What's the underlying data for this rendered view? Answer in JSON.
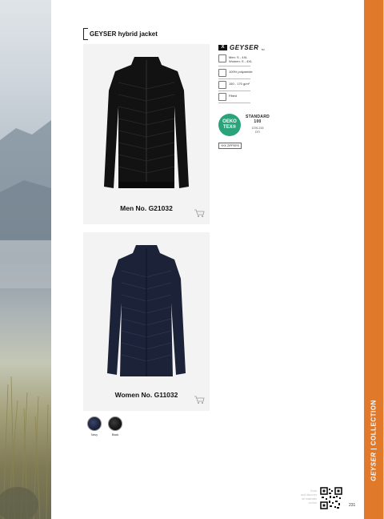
{
  "title": "GEYSER hybrid jacket",
  "brand": {
    "mark": "X",
    "word": "GEYSER",
    "tm": "TM"
  },
  "products": [
    {
      "label": "Men No. G21032",
      "color": "#121212"
    },
    {
      "label": "Women No. G11032",
      "color": "#1c2238"
    }
  ],
  "specs": {
    "sizes": "Men: S - 4XL\nWomen: S - 4XL",
    "material": "100% polyamide",
    "weight": "150 - 170 g/m²",
    "fit": "Fitted"
  },
  "oeko": {
    "badge_line1": "OEKO",
    "badge_line2": "TEX®",
    "standard": "STANDARD\n100",
    "number": "1376-215\nDTI"
  },
  "zipper": "YKK ZIPPERS",
  "swatches": [
    {
      "label": "Navy",
      "color": "#1b2239"
    },
    {
      "label": "Black",
      "color": "#161616"
    }
  ],
  "side_band": {
    "brand": "GEYSER",
    "section": "COLLECTION",
    "color": "#e07a2a"
  },
  "footer_note": "Scan\nand discover\nall materials\non line",
  "page_number": "231"
}
